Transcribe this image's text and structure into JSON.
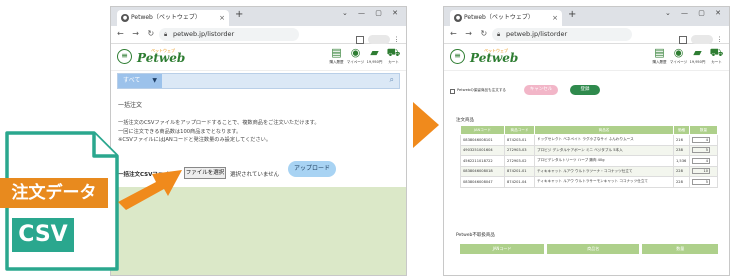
{
  "left_window": {
    "tab_title": "Petweb（ペットウェブ）",
    "url": "petweb.jp/listorder",
    "logo": {
      "main": "Petweb",
      "sub": "ペットウェブ"
    },
    "header_icons": [
      {
        "label": "購入履歴"
      },
      {
        "label": "マイページ"
      },
      {
        "label": "19,950円"
      },
      {
        "label": "カート"
      }
    ],
    "search": {
      "category": "すべて"
    },
    "bulk_title": "一括注文",
    "bulk_desc": [
      "一括注文のCSVファイルをアップロードすることで、複数商品をご注文いただけます。",
      "一回に注文できる商品数は100商品までとなります。",
      "※CSVファイルにはJANコードと発注数量のみ設定してください。"
    ],
    "upload": {
      "label": "一括注文CSVファイル：",
      "choose_button": "ファイルを選択",
      "no_file": "選択されていません",
      "upload_button": "アップロード"
    }
  },
  "right_window": {
    "tab_title": "Petweb（ペットウェブ）",
    "url": "petweb.jp/listorder",
    "checkbox_label": "Petwebの保留商品も注文する",
    "cancel_button": "キャンセル",
    "register_button": "登録",
    "section_title": "注文商品",
    "table": {
      "headers": [
        "JANコード",
        "商品コード",
        "商品名",
        "価格",
        "数量"
      ],
      "rows": [
        {
          "jan": "0838046008101",
          "code": "874203-01",
          "name": "ドッグセレクト ベネペイト ラグ小さなサイ ふんわりムース",
          "price": "216",
          "qty": "4"
        },
        {
          "jan": "4903251001604",
          "code": "272903-03",
          "name": "プロビジ デンタルケアボーン ミニ ベジタブル 5本入",
          "price": "238",
          "qty": "5"
        },
        {
          "jan": "4562211018722",
          "code": "272903-02",
          "name": "プロビデンタルトリーツ ハーブ 鶏肉 40g",
          "price": "1,536",
          "qty": "4"
        },
        {
          "jan": "0838046008018",
          "code": "874201-01",
          "name": "ティキキャット ルアウ ウルトラツーナ・ココナッツ仕立て",
          "price": "228",
          "qty": "10"
        },
        {
          "jan": "0838046008047",
          "code": "874201-04",
          "name": "ティキキャット ルアウ ウルトラサーモンキャット ココナッツ仕立て",
          "price": "228",
          "qty": "5"
        }
      ]
    },
    "section2_title": "Petweb不取扱商品",
    "bottom_headers": [
      "JANコード",
      "商品名",
      "数量"
    ]
  },
  "csv_document": {
    "label_line1": "注文データ",
    "label_line2": "CSV"
  },
  "colors": {
    "green": "#2e7d32",
    "table_header": "#aed08b",
    "orange": "#e88a1e",
    "teal": "#2aa78e",
    "arrow": "#f08a1c",
    "upload_button": "#a8d3f3"
  }
}
